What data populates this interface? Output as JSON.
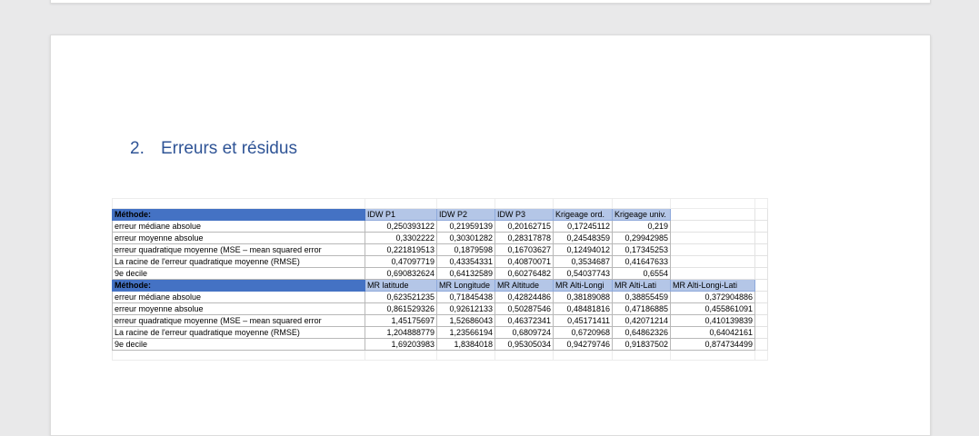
{
  "section": {
    "number": "2.",
    "title": "Erreurs et résidus"
  },
  "table1": {
    "header": [
      "Méthode:",
      "IDW P1",
      "IDW P2",
      "IDW P3",
      "Krigeage ord.",
      "Krigeage univ."
    ],
    "rows": [
      [
        "erreur médiane absolue",
        "0,250393122",
        "0,21959139",
        "0,20162715",
        "0,17245112",
        "0,219"
      ],
      [
        "erreur moyenne absolue",
        "0,3302222",
        "0,30301282",
        "0,28317878",
        "0,24548359",
        "0,29942985"
      ],
      [
        "erreur quadratique moyenne (MSE – mean squared error",
        "0,221819513",
        "0,1879598",
        "0,16703627",
        "0,12494012",
        "0,17345253"
      ],
      [
        "La racine de l'erreur quadratique moyenne (RMSE)",
        "0,47097719",
        "0,43354331",
        "0,40870071",
        "0,3534687",
        "0,41647633"
      ],
      [
        "9e decile",
        "0,690832624",
        "0,64132589",
        "0,60276482",
        "0,54037743",
        "0,6554"
      ]
    ]
  },
  "table2": {
    "header": [
      "Méthode:",
      "MR latitude",
      "MR Longitude",
      "MR Altitude",
      "MR Alti-Longi",
      "MR Alti-Lati",
      "MR Alti-Longi-Lati"
    ],
    "rows": [
      [
        "erreur médiane absolue",
        "0,623521235",
        "0,71845438",
        "0,42824486",
        "0,38189088",
        "0,38855459",
        "0,372904886"
      ],
      [
        "erreur moyenne absolue",
        "0,861529326",
        "0,92612133",
        "0,50287546",
        "0,48481816",
        "0,47186885",
        "0,455861091"
      ],
      [
        "erreur quadratique moyenne (MSE – mean squared error",
        "1,45175697",
        "1,52686043",
        "0,46372341",
        "0,45171411",
        "0,42071214",
        "0,410139839"
      ],
      [
        "La racine de l'erreur quadratique moyenne (RMSE)",
        "1,204888779",
        "1,23566194",
        "0,6809724",
        "0,6720968",
        "0,64862326",
        "0,64042161"
      ],
      [
        "9e decile",
        "1,69203983",
        "1,8384018",
        "0,95305034",
        "0,94279746",
        "0,91837502",
        "0,874734499"
      ]
    ]
  }
}
